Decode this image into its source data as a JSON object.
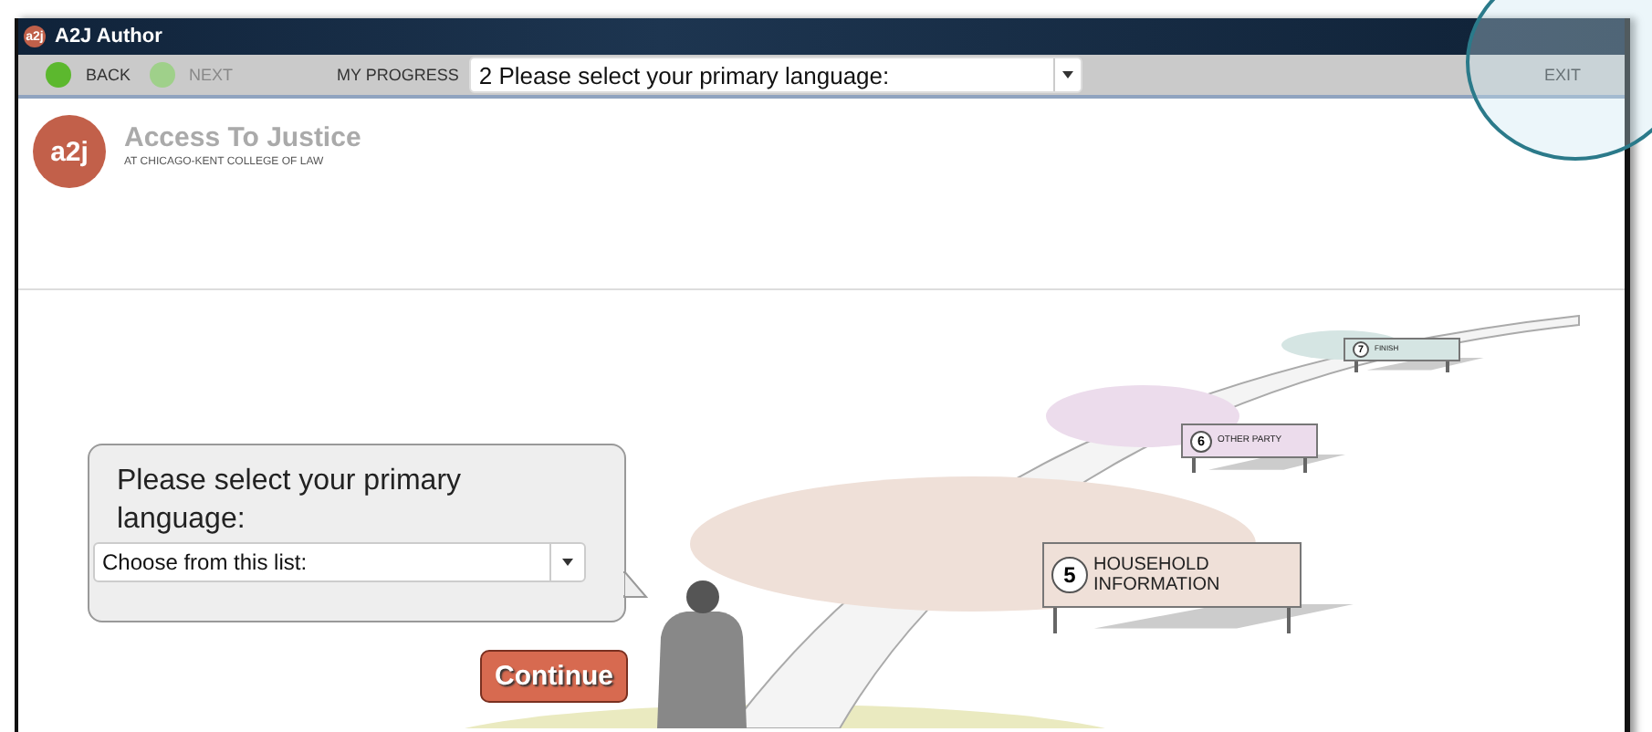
{
  "window": {
    "title": "A2J Author",
    "logo": "a2j"
  },
  "toolbar": {
    "back": "BACK",
    "next": "NEXT",
    "next_disabled": true,
    "progress_label": "MY PROGRESS",
    "progress_value": "2 Please select your primary language:",
    "exit": "EXIT"
  },
  "header": {
    "logo": "a2j",
    "title": "Access To Justice",
    "subtitle": "AT CHICAGO-KENT COLLEGE OF LAW"
  },
  "question": {
    "text": "Please select your primary language:",
    "select_value": "Choose from this list:",
    "continue": "Continue"
  },
  "signs": [
    {
      "number": "5",
      "label": "HOUSEHOLD INFORMATION",
      "color": "#efe0d8"
    },
    {
      "number": "6",
      "label": "OTHER PARTY",
      "color": "#ecdcec"
    },
    {
      "number": "7",
      "label": "FINISH",
      "color": "#d5e5e3"
    }
  ]
}
